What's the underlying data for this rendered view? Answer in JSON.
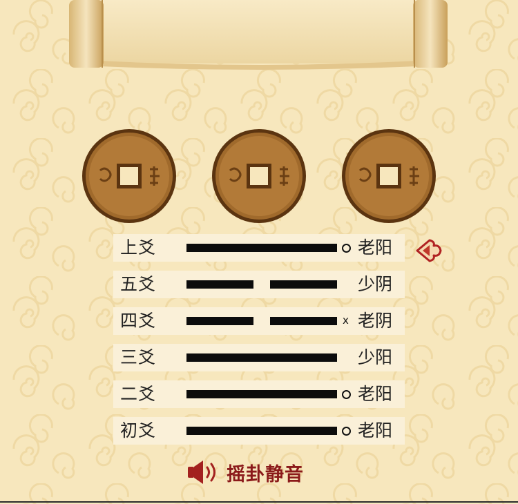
{
  "lines": [
    {
      "label": "上爻",
      "type": "solid",
      "mark": "circle",
      "value": "老阳",
      "selected": true
    },
    {
      "label": "五爻",
      "type": "broken",
      "mark": "",
      "value": "少阴",
      "selected": false
    },
    {
      "label": "四爻",
      "type": "broken",
      "mark": "x",
      "value": "老阴",
      "selected": false
    },
    {
      "label": "三爻",
      "type": "solid",
      "mark": "",
      "value": "少阳",
      "selected": false
    },
    {
      "label": "二爻",
      "type": "solid",
      "mark": "circle",
      "value": "老阳",
      "selected": false
    },
    {
      "label": "初爻",
      "type": "solid",
      "mark": "circle",
      "value": "老阳",
      "selected": false
    }
  ],
  "mute": {
    "label": "摇卦静音",
    "icon": "speaker-icon"
  },
  "colors": {
    "background": "#f7e7bd",
    "accent": "#8b1a1a",
    "line": "#0c0c0c"
  },
  "coins": [
    "coin-icon",
    "coin-icon",
    "coin-icon"
  ]
}
